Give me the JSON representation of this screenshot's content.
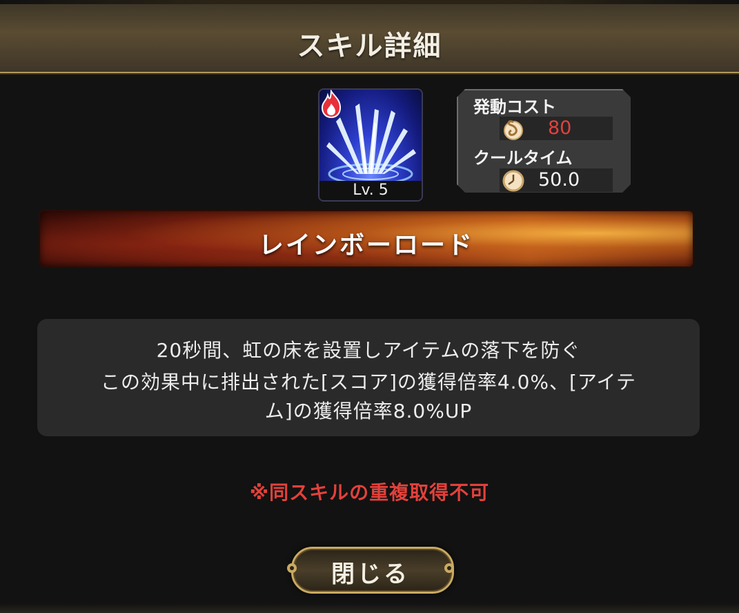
{
  "header": {
    "title": "スキル詳細"
  },
  "skill": {
    "level_label": "Lv. 5",
    "name": "レインボーロード",
    "element_icon": "fire-icon",
    "icon_name": "light-burst-skill-icon"
  },
  "stats": {
    "cost_label": "発動コスト",
    "cost_value": "80",
    "cost_icon": "swirl-icon",
    "cost_color": "#e2413b",
    "cooltime_label": "クールタイム",
    "cooltime_value": "50.0",
    "cooltime_icon": "clock-icon"
  },
  "description": {
    "line1": "20秒間、虹の床を設置しアイテムの落下を防ぐ",
    "line2": "この効果中に排出された[スコア]の獲得倍率4.0%、[アイテ",
    "line3": "ム]の獲得倍率8.0%UP"
  },
  "warning": "※同スキルの重複取得不可",
  "buttons": {
    "close_label": "閉じる"
  },
  "colors": {
    "accent_gold": "#c9aa62",
    "warning_red": "#e2413b"
  }
}
